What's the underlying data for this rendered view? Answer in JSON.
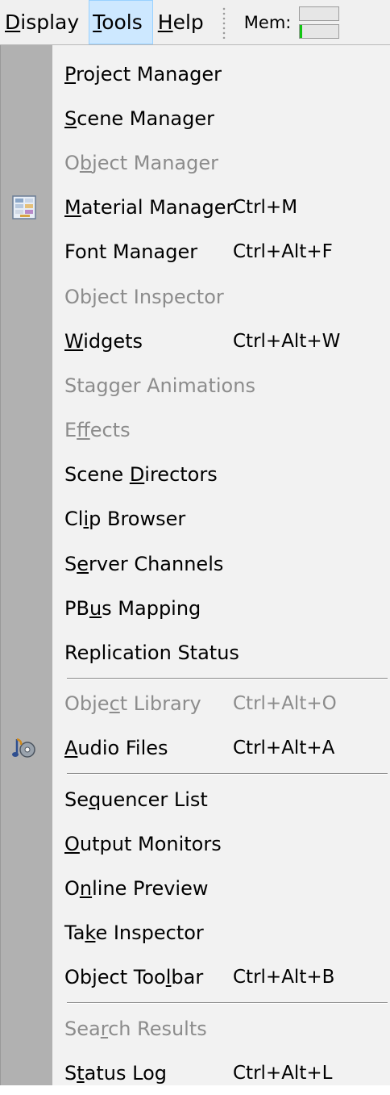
{
  "menubar": {
    "menus": [
      {
        "label_pre": "",
        "mnemonic": "D",
        "label_post": "isplay"
      },
      {
        "label_pre": "",
        "mnemonic": "T",
        "label_post": "ools"
      },
      {
        "label_pre": "",
        "mnemonic": "H",
        "label_post": "elp"
      }
    ],
    "mem_label": "Mem:"
  },
  "menu_items": [
    {
      "pre": "",
      "mn": "P",
      "post": "roject Manager",
      "shortcut": "",
      "disabled": false
    },
    {
      "pre": "",
      "mn": "S",
      "post": "cene Manager",
      "shortcut": "",
      "disabled": false
    },
    {
      "pre": "O",
      "mn": "b",
      "post": "ject Manager",
      "shortcut": "",
      "disabled": true
    },
    {
      "pre": "",
      "mn": "M",
      "post": "aterial Manager",
      "shortcut": "Ctrl+M",
      "disabled": false,
      "icon": "material-palette-icon"
    },
    {
      "pre": "Font Manager",
      "mn": "",
      "post": "",
      "shortcut": "Ctrl+Alt+F",
      "disabled": false
    },
    {
      "pre": "Object Inspector",
      "mn": "",
      "post": "",
      "shortcut": "",
      "disabled": true
    },
    {
      "pre": "",
      "mn": "W",
      "post": "idgets",
      "shortcut": "Ctrl+Alt+W",
      "disabled": false
    },
    {
      "pre": "Stagger Animations",
      "mn": "",
      "post": "",
      "shortcut": "",
      "disabled": true
    },
    {
      "pre": "E",
      "mn": "f",
      "post": "fects",
      "shortcut": "",
      "disabled": true
    },
    {
      "pre": "Scene ",
      "mn": "D",
      "post": "irectors",
      "shortcut": "",
      "disabled": false
    },
    {
      "pre": "Cl",
      "mn": "i",
      "post": "p Browser",
      "shortcut": "",
      "disabled": false
    },
    {
      "pre": "S",
      "mn": "e",
      "post": "rver Channels",
      "shortcut": "",
      "disabled": false
    },
    {
      "pre": "PB",
      "mn": "u",
      "post": "s Mapping",
      "shortcut": "",
      "disabled": false
    },
    {
      "pre": "Replication Status",
      "mn": "",
      "post": "",
      "shortcut": "",
      "disabled": false,
      "separator_after": true
    },
    {
      "pre": "Obje",
      "mn": "c",
      "post": "t Library",
      "shortcut": "Ctrl+Alt+O",
      "disabled": true
    },
    {
      "pre": "",
      "mn": "A",
      "post": "udio Files",
      "shortcut": "Ctrl+Alt+A",
      "disabled": false,
      "icon": "audio-files-icon",
      "separator_after": true
    },
    {
      "pre": "Se",
      "mn": "q",
      "post": "uencer List",
      "shortcut": "",
      "disabled": false
    },
    {
      "pre": "",
      "mn": "O",
      "post": "utput Monitors",
      "shortcut": "",
      "disabled": false
    },
    {
      "pre": "O",
      "mn": "n",
      "post": "line Preview",
      "shortcut": "",
      "disabled": false
    },
    {
      "pre": "Ta",
      "mn": "k",
      "post": "e Inspector",
      "shortcut": "",
      "disabled": false
    },
    {
      "pre": "Object Too",
      "mn": "l",
      "post": "bar",
      "shortcut": "Ctrl+Alt+B",
      "disabled": false,
      "separator_after": true
    },
    {
      "pre": "Sea",
      "mn": "r",
      "post": "ch Results",
      "shortcut": "",
      "disabled": true
    },
    {
      "pre": "S",
      "mn": "t",
      "post": "atus Log",
      "shortcut": "Ctrl+Alt+L",
      "disabled": false
    }
  ]
}
